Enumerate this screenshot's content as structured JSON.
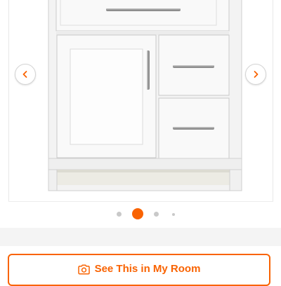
{
  "gallery": {
    "image_subject": "white bathroom vanity cabinet with one door and drawers",
    "prev_icon": "chevron-left-icon",
    "next_icon": "chevron-right-icon",
    "pagination": {
      "total_dots": 4,
      "active_index": 1
    }
  },
  "room_button": {
    "label": "See This in My Room",
    "icon": "camera-icon",
    "accent_color": "#f96302"
  },
  "colors": {
    "accent": "#f96302",
    "cabinet": "#f5f5f5",
    "inactive_dot": "#c9c9c9",
    "divider_band": "#f4f4f4"
  }
}
